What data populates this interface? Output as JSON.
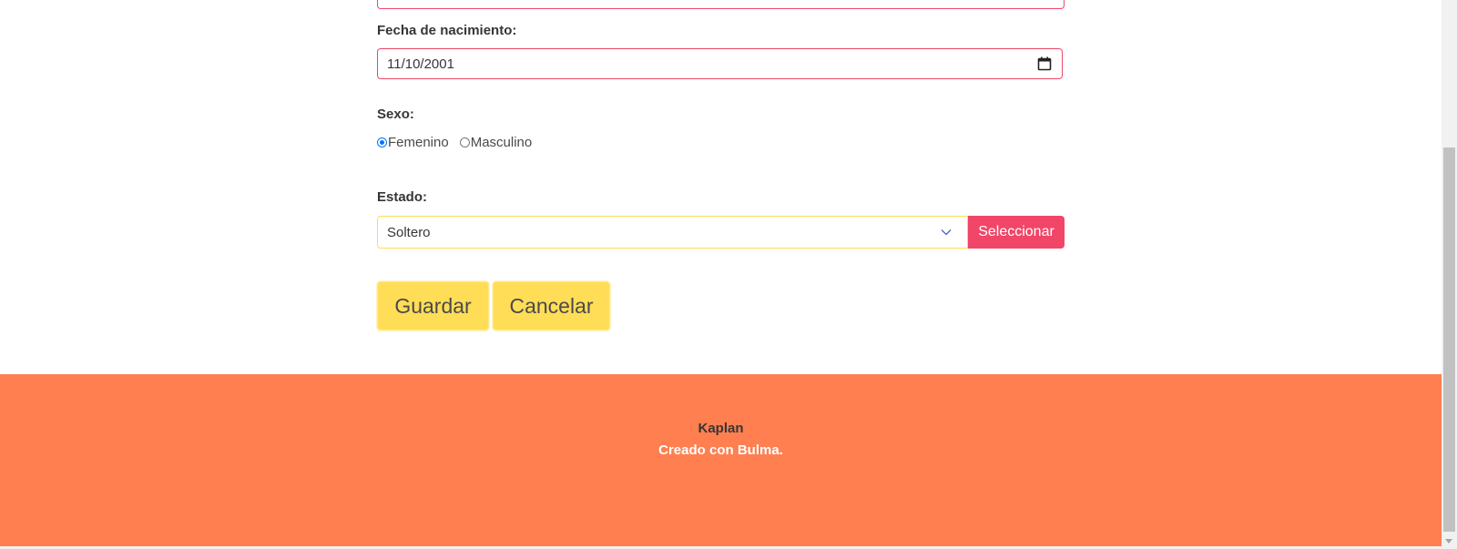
{
  "form": {
    "birth_label": "Fecha de nacimiento:",
    "birth_value": "11/10/2001",
    "sex_label": "Sexo:",
    "sex_options": [
      {
        "label": "Femenino",
        "checked": true
      },
      {
        "label": "Masculino",
        "checked": false
      }
    ],
    "status_label": "Estado:",
    "status_value": "Soltero",
    "select_button": "Seleccionar",
    "save_button": "Guardar",
    "cancel_button": "Cancelar"
  },
  "footer": {
    "title": "Kaplan",
    "subtitle": "Creado con Bulma."
  },
  "colors": {
    "danger": "#f14668",
    "warning": "#ffdd57",
    "footer_bg": "#ff7f50",
    "radio_accent": "#0075ff"
  },
  "icons": {
    "date": "calendar-icon",
    "select": "chevron-down-icon"
  }
}
